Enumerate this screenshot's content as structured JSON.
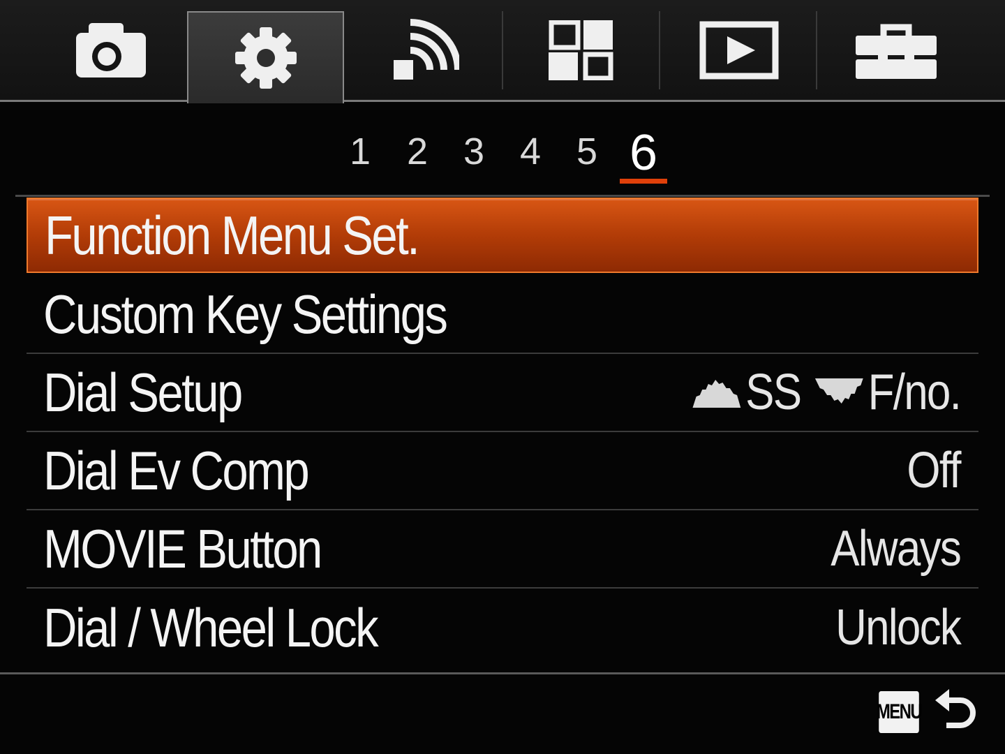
{
  "tabs": [
    {
      "name": "camera",
      "icon": "camera-icon"
    },
    {
      "name": "settings",
      "icon": "gear-icon",
      "active": true
    },
    {
      "name": "wireless",
      "icon": "wireless-icon"
    },
    {
      "name": "application",
      "icon": "application-grid-icon"
    },
    {
      "name": "playback",
      "icon": "playback-icon"
    },
    {
      "name": "setup",
      "icon": "toolbox-icon"
    }
  ],
  "pages": {
    "numbers": [
      "1",
      "2",
      "3",
      "4",
      "5",
      "6"
    ],
    "active": "6"
  },
  "menu": {
    "items": [
      {
        "label": "Function Menu Set.",
        "value": "",
        "selected": true
      },
      {
        "label": "Custom Key Settings",
        "value": ""
      },
      {
        "label": "Dial Setup",
        "value_front": "SS",
        "value_rear": "F/no."
      },
      {
        "label": "Dial Ev Comp",
        "value": "Off"
      },
      {
        "label": "MOVIE Button",
        "value": "Always"
      },
      {
        "label": "Dial / Wheel Lock",
        "value": "Unlock"
      }
    ]
  },
  "footer": {
    "menu_label": "MENU",
    "back_icon": "return-arrow-icon"
  },
  "colors": {
    "accent": "#d85614",
    "underline": "#e0400a",
    "background": "#050505"
  }
}
